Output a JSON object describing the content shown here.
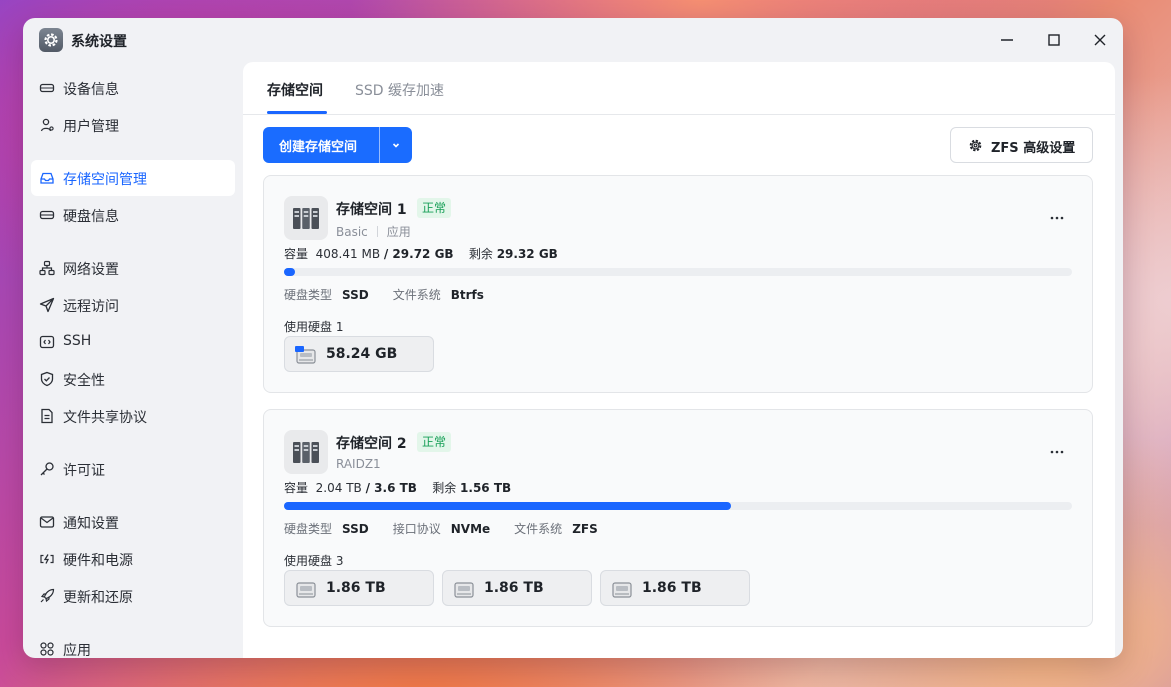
{
  "window": {
    "title": "系统设置"
  },
  "sidebar": {
    "items": [
      {
        "label": "设备信息",
        "icon": "device-icon",
        "active": false
      },
      {
        "label": "用户管理",
        "icon": "user-icon",
        "active": false
      },
      {
        "label": "存储空间管理",
        "icon": "storage-icon",
        "active": true
      },
      {
        "label": "硬盘信息",
        "icon": "disk-icon",
        "active": false
      },
      {
        "label": "网络设置",
        "icon": "network-icon",
        "active": false
      },
      {
        "label": "远程访问",
        "icon": "send-icon",
        "active": false
      },
      {
        "label": "SSH",
        "icon": "ssh-icon",
        "active": false
      },
      {
        "label": "安全性",
        "icon": "shield-icon",
        "active": false
      },
      {
        "label": "文件共享协议",
        "icon": "file-icon",
        "active": false
      },
      {
        "label": "许可证",
        "icon": "key-icon",
        "active": false
      },
      {
        "label": "通知设置",
        "icon": "mail-icon",
        "active": false
      },
      {
        "label": "硬件和电源",
        "icon": "power-icon",
        "active": false
      },
      {
        "label": "更新和还原",
        "icon": "rocket-icon",
        "active": false
      },
      {
        "label": "应用",
        "icon": "apps-icon",
        "active": false
      }
    ]
  },
  "tabs": [
    {
      "label": "存储空间",
      "active": true
    },
    {
      "label": "SSD 缓存加速",
      "active": false
    }
  ],
  "toolbar": {
    "create_label": "创建存储空间",
    "zfs_label": "ZFS 高级设置"
  },
  "labels": {
    "capacity": "容量",
    "remaining": "剩余",
    "disk_type": "硬盘类型",
    "interface": "接口协议",
    "filesystem": "文件系统",
    "used_disks": "使用硬盘"
  },
  "pools": [
    {
      "name": "存储空间 1",
      "status": "正常",
      "sub_type": "Basic",
      "sub_app": "应用",
      "used": "408.41 MB",
      "total": "/ 29.72 GB",
      "free": "29.32 GB",
      "usage_fraction": 0.014,
      "disk_type": "SSD",
      "filesystem": "Btrfs",
      "disk_count": "1",
      "disks": [
        "58.24 GB"
      ]
    },
    {
      "name": "存储空间 2",
      "status": "正常",
      "sub_type": "RAIDZ1",
      "used": "2.04 TB",
      "total": "/ 3.6 TB",
      "free": "1.56 TB",
      "usage_fraction": 0.567,
      "disk_type": "SSD",
      "interface": "NVMe",
      "filesystem": "ZFS",
      "disk_count": "3",
      "disks": [
        "1.86 TB",
        "1.86 TB",
        "1.86 TB"
      ]
    }
  ],
  "colors": {
    "accent": "#1a66ff",
    "status_ok": "#18a058",
    "status_ok_bg": "#e3f6ea"
  }
}
